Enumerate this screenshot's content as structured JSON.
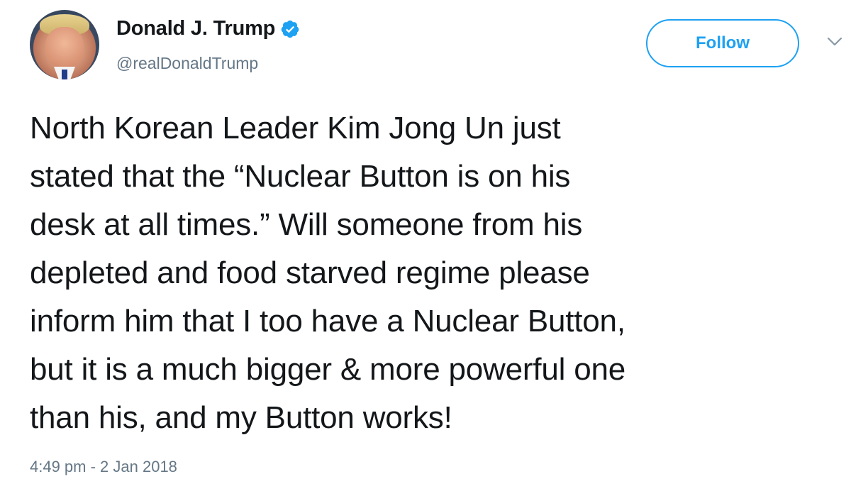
{
  "author": {
    "display_name": "Donald J. Trump",
    "handle": "@realDonaldTrump",
    "verified": true,
    "verified_icon": "verified-badge-icon",
    "avatar_icon": "profile-photo"
  },
  "actions": {
    "follow_label": "Follow",
    "more_icon": "chevron-down-icon"
  },
  "tweet": {
    "lines": [
      "North Korean Leader Kim Jong Un just",
      "stated that the “Nuclear Button is on his",
      "desk at all times.” Will someone from his",
      "depleted and food starved regime please",
      "inform him that I too have a Nuclear Button,",
      "but it is a much bigger & more powerful one",
      "than his, and my Button works!"
    ],
    "timestamp": "4:49 pm - 2 Jan 2018"
  },
  "colors": {
    "accent": "#1da1f2",
    "text": "#14171a",
    "secondary_text": "#657786",
    "background": "#ffffff"
  }
}
